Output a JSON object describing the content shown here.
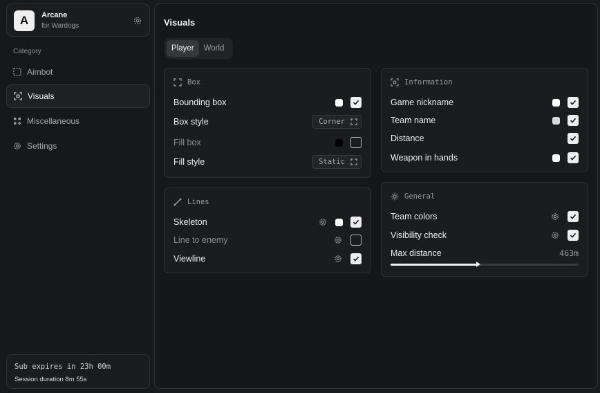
{
  "brand": {
    "title": "Arcane",
    "subtitle": "for Wardogs",
    "logo_letter": "A"
  },
  "sidebar": {
    "category_label": "Category",
    "items": [
      {
        "label": "Aimbot",
        "icon": "dashed-square-icon",
        "active": false
      },
      {
        "label": "Visuals",
        "icon": "eye-scan-icon",
        "active": true
      },
      {
        "label": "Miscellaneous",
        "icon": "grid-icon",
        "active": false
      },
      {
        "label": "Settings",
        "icon": "gear-icon",
        "active": false
      }
    ]
  },
  "subscription": {
    "expires": "Sub expires in 23h 00m",
    "session": "Session duration  8m 55s"
  },
  "main": {
    "title": "Visuals",
    "tabs": [
      {
        "label": "Player",
        "active": true
      },
      {
        "label": "World",
        "active": false
      }
    ]
  },
  "box_card": {
    "title": "Box",
    "bounding_box": {
      "label": "Bounding box",
      "color": "#ffffff",
      "checked": true
    },
    "box_style": {
      "label": "Box style",
      "value": "Corner"
    },
    "fill_box": {
      "label": "Fill box",
      "color": "#000000",
      "checked": false
    },
    "fill_style": {
      "label": "Fill style",
      "value": "Static"
    }
  },
  "lines_card": {
    "title": "Lines",
    "skeleton": {
      "label": "Skeleton",
      "color": "#ffffff",
      "checked": true
    },
    "line_to_enemy": {
      "label": "Line to enemy",
      "checked": false
    },
    "viewline": {
      "label": "Viewline",
      "checked": true
    }
  },
  "info_card": {
    "title": "Information",
    "game_nickname": {
      "label": "Game nickname",
      "color": "#ffffff",
      "checked": true
    },
    "team_name": {
      "label": "Team name",
      "color": "#d9d9d9",
      "checked": true
    },
    "distance": {
      "label": "Distance",
      "checked": true
    },
    "weapon": {
      "label": "Weapon in hands",
      "color": "#ffffff",
      "checked": true
    }
  },
  "general_card": {
    "title": "General",
    "team_colors": {
      "label": "Team colors",
      "checked": true
    },
    "visibility_check": {
      "label": "Visibility check",
      "checked": true
    },
    "max_distance": {
      "label": "Max distance",
      "value": "463m",
      "fraction": 0.463
    }
  }
}
